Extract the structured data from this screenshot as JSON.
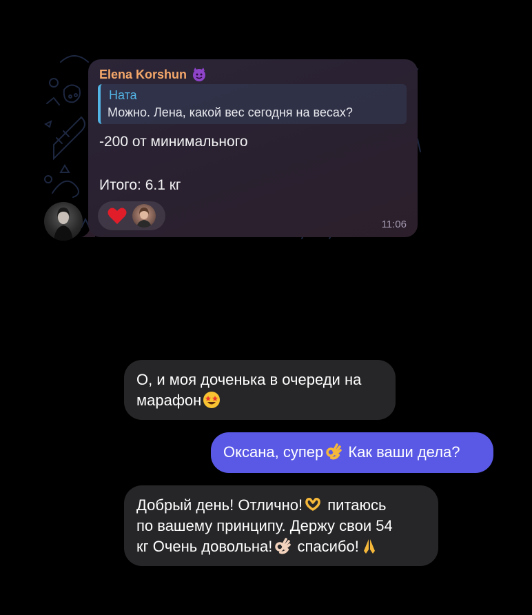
{
  "telegram_message": {
    "sender": "Elena Korshun",
    "sender_emoji": "purple-devil-emoji",
    "reply": {
      "name": "Ната",
      "text": "Можно. Лена, какой вес сегодня на весах?"
    },
    "text_line1": "-200 от минимального",
    "text_line2": "Итого: 6.1 кг",
    "reactions": [
      "red-heart-emoji",
      "user-avatar"
    ],
    "time": "11:06"
  },
  "chat": [
    {
      "side": "incoming",
      "lines": [
        "О, и моя доченька в очереди на",
        "марафон"
      ],
      "emoji": [
        "star-struck-emoji"
      ]
    },
    {
      "side": "outgoing",
      "lines": [
        "Оксана, супер",
        " Как ваши дела?"
      ],
      "emoji": [
        "ok-hand-emoji"
      ]
    },
    {
      "side": "incoming",
      "lines": [
        "Добрый день! Отлично!",
        " питаюсь",
        "по вашему принципу. Держу свои 54",
        "кг Очень довольна!",
        " спасибо!"
      ],
      "emoji": [
        "heart-hands-emoji",
        "ok-hand-light-emoji",
        "folded-hands-emoji"
      ]
    }
  ],
  "colors": {
    "background": "#000000",
    "sender_name": "#f5a86a",
    "reply_accent": "#53b5e6",
    "incoming_bubble": "#262628",
    "outgoing_bubble": "#5a59e6"
  }
}
